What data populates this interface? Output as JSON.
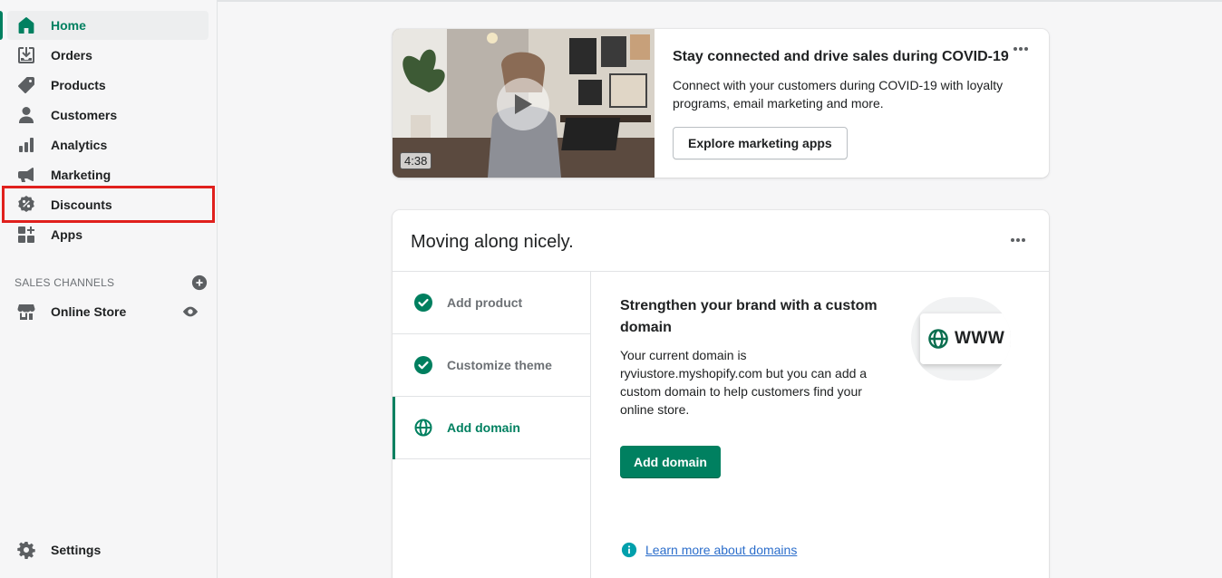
{
  "sidebar": {
    "items": [
      {
        "label": "Home",
        "icon": "home-icon",
        "active": true
      },
      {
        "label": "Orders",
        "icon": "orders-icon"
      },
      {
        "label": "Products",
        "icon": "tag-icon"
      },
      {
        "label": "Customers",
        "icon": "person-icon"
      },
      {
        "label": "Analytics",
        "icon": "bar-chart-icon"
      },
      {
        "label": "Marketing",
        "icon": "megaphone-icon"
      },
      {
        "label": "Discounts",
        "icon": "discount-icon",
        "highlighted": true
      },
      {
        "label": "Apps",
        "icon": "apps-icon"
      }
    ],
    "sales_channels_heading": "SALES CHANNELS",
    "online_store_label": "Online Store",
    "settings_label": "Settings"
  },
  "video_card": {
    "duration": "4:38",
    "title": "Stay connected and drive sales during COVID-19",
    "description": "Connect with your customers during COVID-19 with loyalty programs, email marketing and more.",
    "button_label": "Explore marketing apps"
  },
  "setup_card": {
    "title": "Moving along nicely.",
    "steps": [
      {
        "label": "Add product",
        "status": "complete"
      },
      {
        "label": "Customize theme",
        "status": "complete"
      },
      {
        "label": "Add domain",
        "status": "active"
      }
    ],
    "detail_title": "Strengthen your brand with a custom domain",
    "detail_description": "Your current domain is ryviustore.myshopify.com but you can add a custom domain to help customers find your online store.",
    "primary_button_label": "Add domain",
    "learn_more_label": "Learn more about domains",
    "illustration_text": "WWW"
  },
  "colors": {
    "accent": "#008060",
    "highlight": "#e0201d",
    "link": "#2c6ecb",
    "info": "#00a0ac"
  }
}
